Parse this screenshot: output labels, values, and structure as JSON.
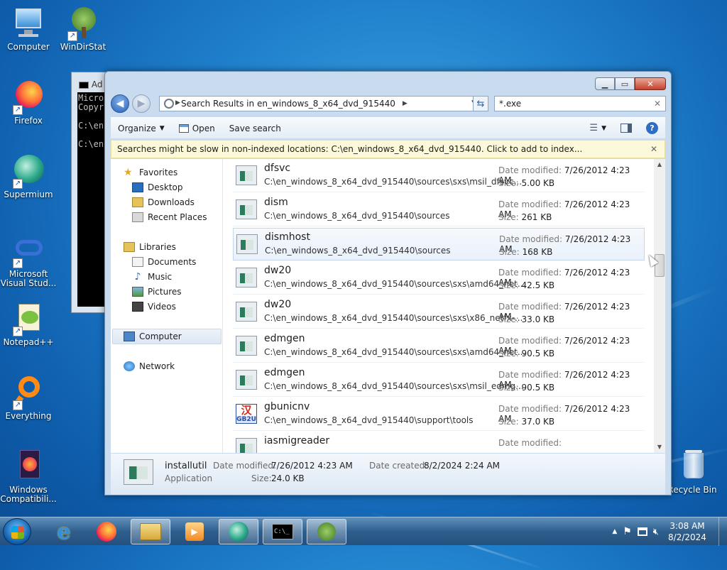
{
  "desktop": {
    "icons": [
      {
        "label": "Computer"
      },
      {
        "label": "WinDirStat"
      },
      {
        "label": "Firefox"
      },
      {
        "label": "Supermium"
      },
      {
        "label": "Microsoft Visual Stud..."
      },
      {
        "label": "Notepad++"
      },
      {
        "label": "Everything"
      },
      {
        "label": "Windows Compatibili..."
      },
      {
        "label": "Recycle Bin"
      }
    ]
  },
  "cmd_window": {
    "title": "Ad",
    "lines": [
      "Micro",
      "Copyr",
      "",
      "C:\\en",
      "",
      "C:\\en"
    ]
  },
  "explorer": {
    "address": "Search Results in en_windows_8_x64_dvd_915440",
    "search_value": "*.exe",
    "toolbar": {
      "organize": "Organize",
      "open": "Open",
      "save_search": "Save search"
    },
    "infobar": "Searches might be slow in non-indexed locations: C:\\en_windows_8_x64_dvd_915440. Click to add to index...",
    "nav": {
      "favorites": "Favorites",
      "desktop": "Desktop",
      "downloads": "Downloads",
      "recent": "Recent Places",
      "libraries": "Libraries",
      "documents": "Documents",
      "music": "Music",
      "pictures": "Pictures",
      "videos": "Videos",
      "computer": "Computer",
      "network": "Network"
    },
    "labels": {
      "date_modified": "Date modified:",
      "size": "Size:"
    },
    "files": [
      {
        "name": "dfsvc",
        "path": "C:\\en_windows_8_x64_dvd_915440\\sources\\sxs\\msil_dfsvc...",
        "date": "7/26/2012 4:23 AM",
        "size": "5.00 KB"
      },
      {
        "name": "dism",
        "path": "C:\\en_windows_8_x64_dvd_915440\\sources",
        "date": "7/26/2012 4:23 AM",
        "size": "261 KB"
      },
      {
        "name": "dismhost",
        "path": "C:\\en_windows_8_x64_dvd_915440\\sources",
        "date": "7/26/2012 4:23 AM",
        "size": "168 KB"
      },
      {
        "name": "dw20",
        "path": "C:\\en_windows_8_x64_dvd_915440\\sources\\sxs\\amd64_net...",
        "date": "7/26/2012 4:23 AM",
        "size": "42.5 KB"
      },
      {
        "name": "dw20",
        "path": "C:\\en_windows_8_x64_dvd_915440\\sources\\sxs\\x86_netfx-...",
        "date": "7/26/2012 4:23 AM",
        "size": "33.0 KB"
      },
      {
        "name": "edmgen",
        "path": "C:\\en_windows_8_x64_dvd_915440\\sources\\sxs\\amd64_net...",
        "date": "7/26/2012 4:23 AM",
        "size": "90.5 KB"
      },
      {
        "name": "edmgen",
        "path": "C:\\en_windows_8_x64_dvd_915440\\sources\\sxs\\msil_edmg...",
        "date": "7/26/2012 4:23 AM",
        "size": "90.5 KB"
      },
      {
        "name": "gbunicnv",
        "path": "C:\\en_windows_8_x64_dvd_915440\\support\\tools",
        "date": "7/26/2012 4:23 AM",
        "size": "37.0 KB"
      },
      {
        "name": "iasmigreader",
        "path": "",
        "date": "",
        "size": ""
      }
    ],
    "details": {
      "name": "installutil",
      "type": "Application",
      "date_modified_label": "Date modified:",
      "date_modified": "7/26/2012 4:23 AM",
      "date_created_label": "Date created:",
      "date_created": "8/2/2024 2:24 AM",
      "size_label": "Size:",
      "size": "24.0 KB"
    }
  },
  "taskbar": {
    "time": "3:08 AM",
    "date": "8/2/2024"
  }
}
